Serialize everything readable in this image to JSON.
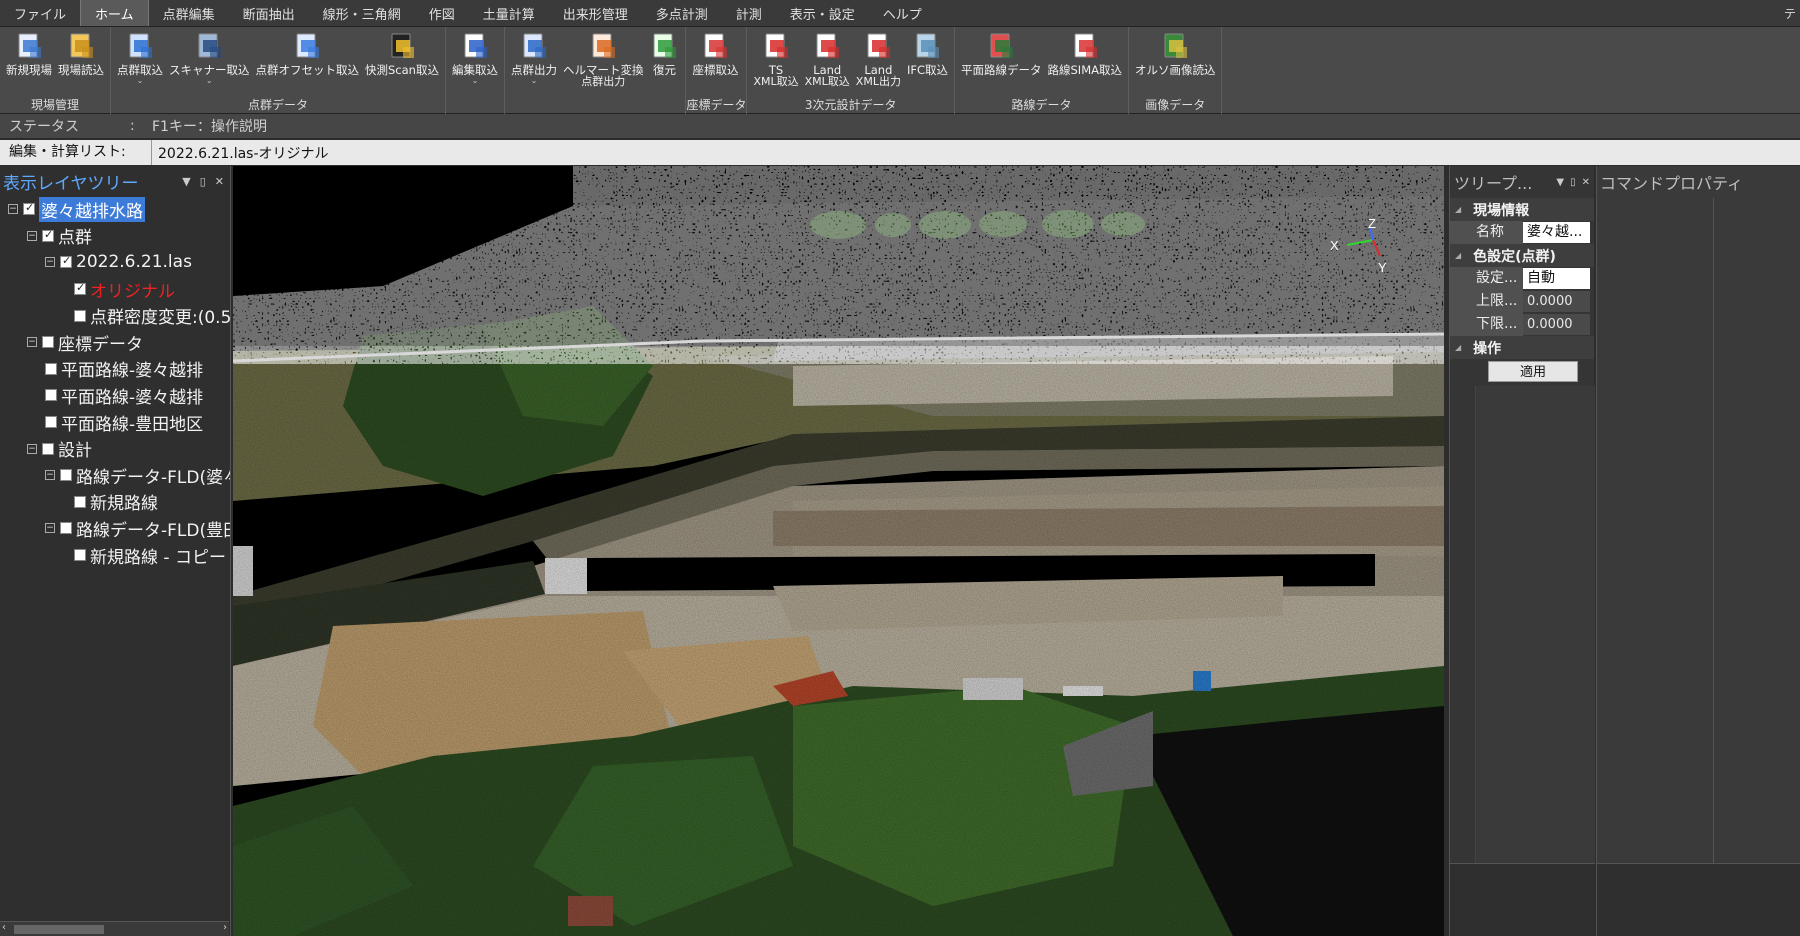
{
  "menu": {
    "items": [
      "ファイル",
      "ホーム",
      "点群編集",
      "断面抽出",
      "線形・三角網",
      "作図",
      "土量計算",
      "出来形管理",
      "多点計測",
      "計測",
      "表示・設定",
      "ヘルプ"
    ],
    "active": "ホーム",
    "right_text": "テ"
  },
  "ribbon": {
    "groups": [
      {
        "name": "現場管理",
        "buttons": [
          {
            "label": "新規現場",
            "icon": "new-site-icon"
          },
          {
            "label": "現場読込",
            "icon": "folder-open-icon"
          }
        ]
      },
      {
        "name": "点群データ",
        "buttons": [
          {
            "label": "点群取込",
            "icon": "pointcloud-import-icon",
            "dropdown": true
          },
          {
            "label": "スキャナー取込",
            "icon": "scanner-import-icon",
            "dropdown": true
          },
          {
            "label": "点群オフセット取込",
            "icon": "offset-import-icon"
          },
          {
            "label": "快測Scan取込",
            "icon": "kaisoku-scan-icon"
          }
        ]
      },
      {
        "name": "",
        "buttons": [
          {
            "label": "編集取込",
            "icon": "edit-import-icon",
            "dropdown": true
          }
        ]
      },
      {
        "name": "",
        "buttons": [
          {
            "label": "点群出力",
            "icon": "pointcloud-export-icon",
            "dropdown": true
          },
          {
            "label": "ヘルマート変換",
            "label2": "点群出力",
            "icon": "helmert-icon"
          },
          {
            "label": "復元",
            "icon": "restore-icon"
          }
        ]
      },
      {
        "name": "座標データ",
        "buttons": [
          {
            "label": "座標取込",
            "icon": "coordinate-import-icon"
          }
        ]
      },
      {
        "name": "3次元設計データ",
        "buttons": [
          {
            "label": "TS",
            "label2": "XML取込",
            "icon": "ts-xml-icon"
          },
          {
            "label": "Land",
            "label2": "XML取込",
            "icon": "landxml-import-icon"
          },
          {
            "label": "Land",
            "label2": "XML出力",
            "icon": "landxml-export-icon"
          },
          {
            "label": "IFC取込",
            "icon": "ifc-import-icon"
          }
        ]
      },
      {
        "name": "路線データ",
        "buttons": [
          {
            "label": "平面路線データ",
            "icon": "plan-route-icon"
          },
          {
            "label": "路線SIMA取込",
            "icon": "sima-import-icon"
          }
        ]
      },
      {
        "name": "画像データ",
        "buttons": [
          {
            "label": "オルソ画像読込",
            "icon": "ortho-image-icon"
          }
        ]
      }
    ]
  },
  "status": {
    "label": "ステータス",
    "sep": ":",
    "value": "F1キー：操作説明"
  },
  "edit_list": {
    "label": "編集・計算リスト:",
    "value": "2022.6.21.las-オリジナル"
  },
  "layer_tree": {
    "title": "表示レイヤツリー",
    "nodes": [
      {
        "label": "婆々越排水路",
        "level": 0,
        "expander": "minus",
        "checked": true,
        "selected": true
      },
      {
        "label": "点群",
        "level": 1,
        "expander": "minus",
        "checked": true
      },
      {
        "label": "2022.6.21.las",
        "level": 2,
        "expander": "minus",
        "checked": true
      },
      {
        "label": "オリジナル",
        "level": 3,
        "expander": "",
        "checked": true,
        "red": true
      },
      {
        "label": "点群密度変更:(0.5",
        "level": 3,
        "expander": "",
        "checked": false
      },
      {
        "label": "座標データ",
        "level": 1,
        "expander": "minus",
        "checked": false
      },
      {
        "label": "平面路線-婆々越排",
        "level": 2,
        "expander": "",
        "checked": false
      },
      {
        "label": "平面路線-婆々越排",
        "level": 2,
        "expander": "",
        "checked": false
      },
      {
        "label": "平面路線-豊田地区",
        "level": 2,
        "expander": "",
        "checked": false
      },
      {
        "label": "設計",
        "level": 1,
        "expander": "minus",
        "checked": false
      },
      {
        "label": "路線データ-FLD(婆々",
        "level": 2,
        "expander": "minus",
        "checked": false
      },
      {
        "label": "新規路線",
        "level": 3,
        "expander": "",
        "checked": false
      },
      {
        "label": "路線データ-FLD(豊田",
        "level": 2,
        "expander": "minus",
        "checked": false
      },
      {
        "label": "新規路線 - コピー",
        "level": 3,
        "expander": "",
        "checked": false
      }
    ]
  },
  "axes": {
    "x": "X",
    "y": "Y",
    "z": "Z"
  },
  "tree_props": {
    "title": "ツリープ...",
    "sections": [
      {
        "name": "現場情報",
        "rows": [
          {
            "key": "名称",
            "value": "婆々越...",
            "style": "white"
          }
        ]
      },
      {
        "name": "色設定(点群)",
        "rows": [
          {
            "key": "設定...",
            "value": "自動",
            "style": "white"
          },
          {
            "key": "上限...",
            "value": "0.0000",
            "style": "dark"
          },
          {
            "key": "下限...",
            "value": "0.0000",
            "style": "dark"
          }
        ]
      },
      {
        "name": "操作",
        "rows": []
      }
    ],
    "apply_button": "適用"
  },
  "command_props": {
    "title": "コマンドプロパティ"
  },
  "colors": {
    "accent": "#3d7bd8",
    "title_blue": "#5fa8ff",
    "red_label": "#ee2222",
    "panel": "#2f2f2f",
    "ribbon": "#4a4a4a"
  }
}
